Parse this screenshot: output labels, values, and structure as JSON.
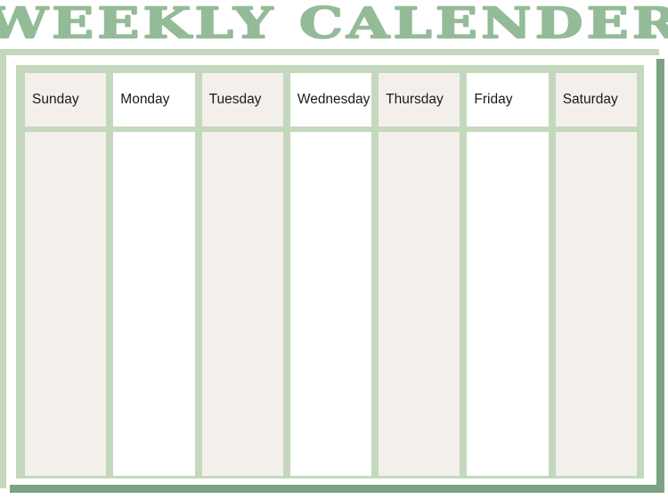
{
  "title": {
    "text": "WEEKLY CALENDER"
  },
  "colors": {
    "title_outline": "#8fb894",
    "frame_light": "#c4d8bd",
    "frame_dark": "#7da283",
    "cell_cream": "#f3f0ec",
    "cell_white": "#ffffff",
    "label_text": "#1a1a1a",
    "page_background": "#ffffff"
  },
  "calendar": {
    "days": [
      {
        "label": "Sunday",
        "tone": "cream",
        "note": ""
      },
      {
        "label": "Monday",
        "tone": "white",
        "note": ""
      },
      {
        "label": "Tuesday",
        "tone": "cream",
        "note": ""
      },
      {
        "label": "Wednesday",
        "tone": "white",
        "note": ""
      },
      {
        "label": "Thursday",
        "tone": "cream",
        "note": ""
      },
      {
        "label": "Friday",
        "tone": "white",
        "note": ""
      },
      {
        "label": "Saturday",
        "tone": "cream",
        "note": ""
      }
    ]
  }
}
